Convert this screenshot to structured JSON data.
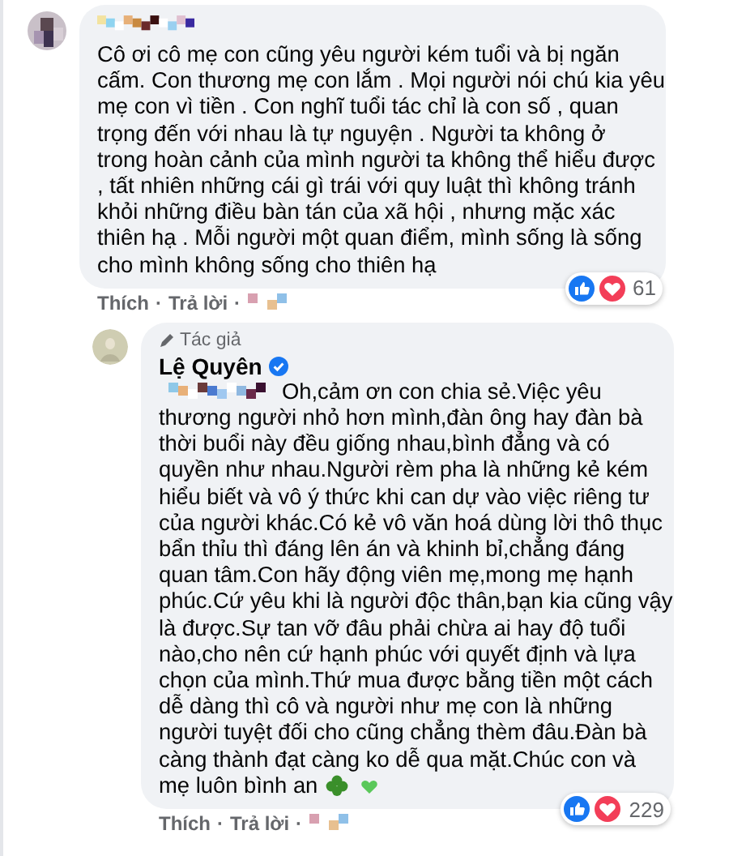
{
  "comments": [
    {
      "kind": "top",
      "text_lines": [
        "Cô ơi cô mẹ con cũng yêu người kém tuổi và bị ngăn",
        "cấm. Con thương mẹ con lắm . Mọi người nói chú kia yêu",
        "mẹ con vì tiền . Con nghĩ tuổi tác chỉ là con số , quan",
        "trọng đến với nhau là tự nguyện . Người ta không ở",
        "trong hoàn cảnh của mình người ta không thể hiểu được",
        ", tất nhiên những cái gì trái với quy luật thì không tránh",
        "khỏi những điều bàn tán của xã hội , nhưng mặc xác",
        "thiên hạ . Mỗi người một quan điểm, mình sống là sống",
        "cho mình không sống cho thiên hạ"
      ],
      "actions": [
        "Thích",
        "Trả lời"
      ],
      "separator": "·",
      "reaction_count": "61"
    },
    {
      "kind": "reply",
      "badge": "Tác giả",
      "author": "Lệ Quyên",
      "verified": true,
      "text_lines": [
        "Oh,cảm ơn con chia sẻ.Việc yêu",
        "thương người nhỏ hơn mình,đàn ông hay đàn bà",
        "thời buổi này đều giống nhau,bình đẳng và có",
        "quyền như nhau.Người rèm pha là những kẻ kém",
        "hiểu biết và vô ý thức khi can dự vào việc riêng tư",
        "của người khác.Có kẻ vô văn hoá dùng lời thô thục",
        "bẩn thỉu thì đáng lên án và khinh bỉ,chẳng đáng",
        "quan tâm.Con hãy động viên mẹ,mong mẹ hạnh",
        "phúc.Cứ yêu khi là người độc thân,bạn kia cũng vậy",
        "là được.Sự tan vỡ đâu phải chừa ai hay độ tuổi",
        "nào,cho nên cứ hạnh phúc với quyết định và lựa",
        "chọn của mình.Thứ mua được bằng tiền một cách",
        "dễ dàng thì cô và người như mẹ con là những",
        "người tuyệt đối cho cũng chẳng thèm đâu.Đàn bà",
        "càng thành đạt càng ko dễ qua mặt.Chúc con và",
        "mẹ luôn bình an"
      ],
      "actions": [
        "Thích",
        "Trả lời"
      ],
      "separator": "·",
      "reaction_count": "229"
    }
  ]
}
